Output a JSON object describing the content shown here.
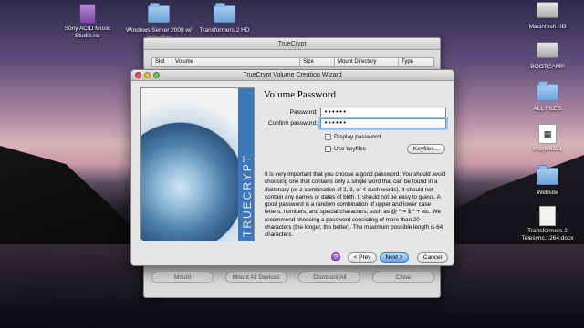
{
  "desktop": {
    "icons": [
      {
        "label": "Sony ACID Music Studio.rar",
        "icon": "rar-archive-icon"
      },
      {
        "label": "Windows Server 2008 w/ activation",
        "icon": "folder-icon"
      },
      {
        "label": "Transformers 2 HD",
        "icon": "folder-icon"
      },
      {
        "label": "Macintosh HD",
        "icon": "hard-disk-icon"
      },
      {
        "label": "BOOTCAMP",
        "icon": "hard-disk-icon"
      },
      {
        "label": "ALL FILES",
        "icon": "folder-icon"
      },
      {
        "label": "image6331",
        "icon": "image-file-icon"
      },
      {
        "label": "Website",
        "icon": "folder-icon"
      },
      {
        "label": "Transformers 2 Telesync...264.docx",
        "icon": "docx-file-icon"
      }
    ]
  },
  "main_window": {
    "title": "TrueCrypt",
    "columns": [
      "Slot",
      "Volume",
      "Size",
      "Mount Directory",
      "Type"
    ],
    "buttons": [
      "Mount",
      "Mount All Devices",
      "Dismount All",
      "Close"
    ]
  },
  "wizard": {
    "title": "TrueCrypt Volume Creation Wizard",
    "brand_text": "TRUECRYPT",
    "heading": "Volume Password",
    "password_label": "Password:",
    "password_value": "••••••",
    "confirm_label": "Confirm password:",
    "confirm_value": "••••••",
    "display_password_label": "Display password",
    "use_keyfiles_label": "Use keyfiles",
    "keyfiles_button": "Keyfiles...",
    "info": "It is very important that you choose a good password. You should avoid choosing one that contains only a single word that can be found in a dictionary (or a combination of 2, 3, or 4 such words). It should not contain any names or dates of birth. It should not be easy to guess. A good password is a random combination of upper and lower case letters, numbers, and special characters, such as @ ^ = $ * + etc. We recommend choosing a password consisting of more than 20 characters (the longer, the better). The maximum possible length is 64 characters.",
    "help_label": "?",
    "prev_button": "< Prev",
    "next_button": "Next >",
    "cancel_button": "Cancel"
  },
  "colors": {
    "accent_blue": "#5f9fe6",
    "brand_strip": "#3f78b8"
  }
}
